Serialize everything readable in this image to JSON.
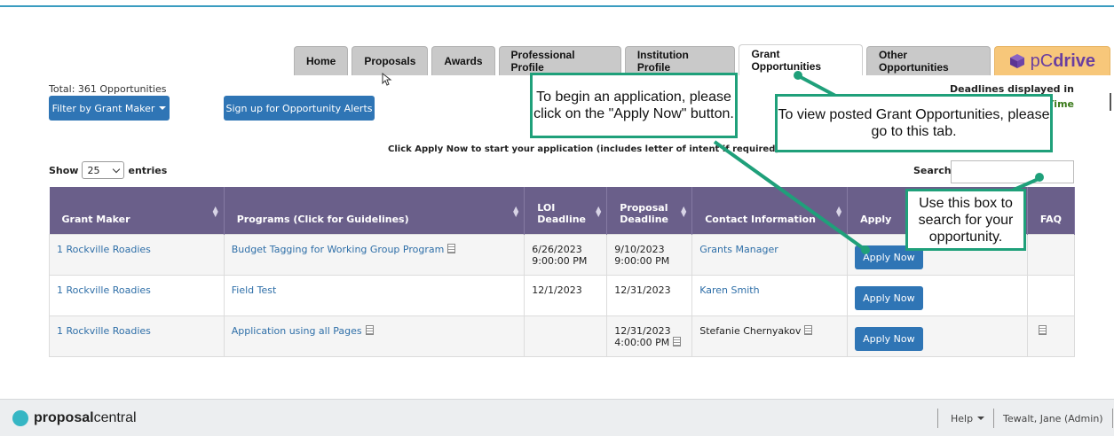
{
  "tabs": [
    {
      "label": "Home"
    },
    {
      "label": "Proposals"
    },
    {
      "label": "Awards"
    },
    {
      "label": "Professional Profile"
    },
    {
      "label": "Institution Profile"
    },
    {
      "label": "Grant Opportunities"
    },
    {
      "label": "Other Opportunities"
    }
  ],
  "pcdrive": {
    "p": "pC",
    "d": "drive"
  },
  "total": "Total: 361 Opportunities",
  "filter_label": "Filter by Grant Maker",
  "alerts_label": "Sign up for Opportunity Alerts",
  "deadlines_note": "Deadlines displayed in",
  "deadlines_time": "Time",
  "apply_instruction": "Click Apply Now to start your application (includes letter of intent if required)",
  "show": {
    "prefix": "Show",
    "value": "25",
    "suffix": "entries"
  },
  "search_label": "Search:",
  "columns": [
    "Grant Maker",
    "Programs (Click for Guidelines)",
    "LOI Deadline",
    "Proposal Deadline",
    "Contact Information",
    "Apply",
    "FAQ"
  ],
  "rows": [
    {
      "maker": "1 Rockville Roadies",
      "program": "Budget Tagging for Working Group Program",
      "loi": [
        "6/26/2023",
        "9:00:00 PM"
      ],
      "proposal": [
        "9/10/2023",
        "9:00:00 PM"
      ],
      "contact": "Grants Manager",
      "apply": "Apply Now"
    },
    {
      "maker": "1 Rockville Roadies",
      "program": "Field Test",
      "loi": [
        "12/1/2023",
        ""
      ],
      "proposal": [
        "12/31/2023",
        ""
      ],
      "contact": "Karen Smith",
      "apply": "Apply Now"
    },
    {
      "maker": "1 Rockville Roadies",
      "program": "Application using all Pages",
      "loi": [
        "",
        ""
      ],
      "proposal": [
        "12/31/2023",
        "4:00:00 PM"
      ],
      "contact": "Stefanie Chernyakov",
      "apply": "Apply Now"
    }
  ],
  "callouts": {
    "apply": "To begin an application, please click on the \"Apply Now\" button.",
    "tab": "To view posted Grant Opportunities, please go to this tab.",
    "search": "Use this box to search for your opportunity."
  },
  "footer": {
    "logo_bold": "proposal",
    "logo_rest": "central",
    "help": "Help",
    "user": "Tewalt, Jane (Admin)"
  },
  "colors": {
    "accent": "#2f75b5",
    "header": "#6a5f8a",
    "callout": "#1fa07a"
  }
}
